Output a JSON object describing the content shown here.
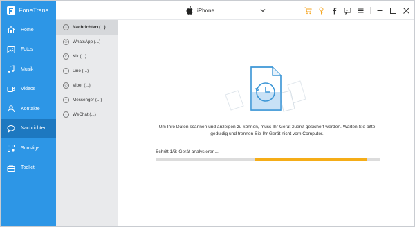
{
  "app": {
    "name": "FoneTrans"
  },
  "header": {
    "device": "iPhone",
    "icons": [
      "cart-icon",
      "key-icon",
      "facebook-icon",
      "chat-icon",
      "menu-icon",
      "minimize-icon",
      "maximize-icon",
      "close-icon"
    ]
  },
  "sidebar": {
    "items": [
      {
        "label": "Home",
        "icon": "home-icon"
      },
      {
        "label": "Fotos",
        "icon": "photo-icon"
      },
      {
        "label": "Musik",
        "icon": "music-icon"
      },
      {
        "label": "Videos",
        "icon": "video-icon"
      },
      {
        "label": "Kontakte",
        "icon": "contact-icon"
      },
      {
        "label": "Nachrichten",
        "icon": "message-icon",
        "active": true
      },
      {
        "label": "Sonstige",
        "icon": "other-icon"
      },
      {
        "label": "Toolkit",
        "icon": "toolkit-icon"
      }
    ]
  },
  "sublist": {
    "items": [
      {
        "label": "Nachrichten (...)",
        "active": true
      },
      {
        "label": "WhatsApp (...)"
      },
      {
        "label": "Kik (...)"
      },
      {
        "label": "Line (...)"
      },
      {
        "label": "Viber (...)"
      },
      {
        "label": "Messenger (...)"
      },
      {
        "label": "WeChat (...)"
      }
    ]
  },
  "main": {
    "message": "Um Ihre Daten scannen und anzeigen zu können, muss Ihr Gerät zuerst gesichert werden. Warten Sie bitte geduldig und trennen Sie Ihr Gerät nicht vom Computer.",
    "step": "Schritt 1/3: Gerät analysieren...",
    "progress": {
      "start": 0.44,
      "end": 0.94
    }
  },
  "colors": {
    "sidebar": "#2d96e6",
    "sidebar_active": "#1d78c0",
    "progress": "#f5ad18",
    "accent_icons": "#f5a623"
  }
}
